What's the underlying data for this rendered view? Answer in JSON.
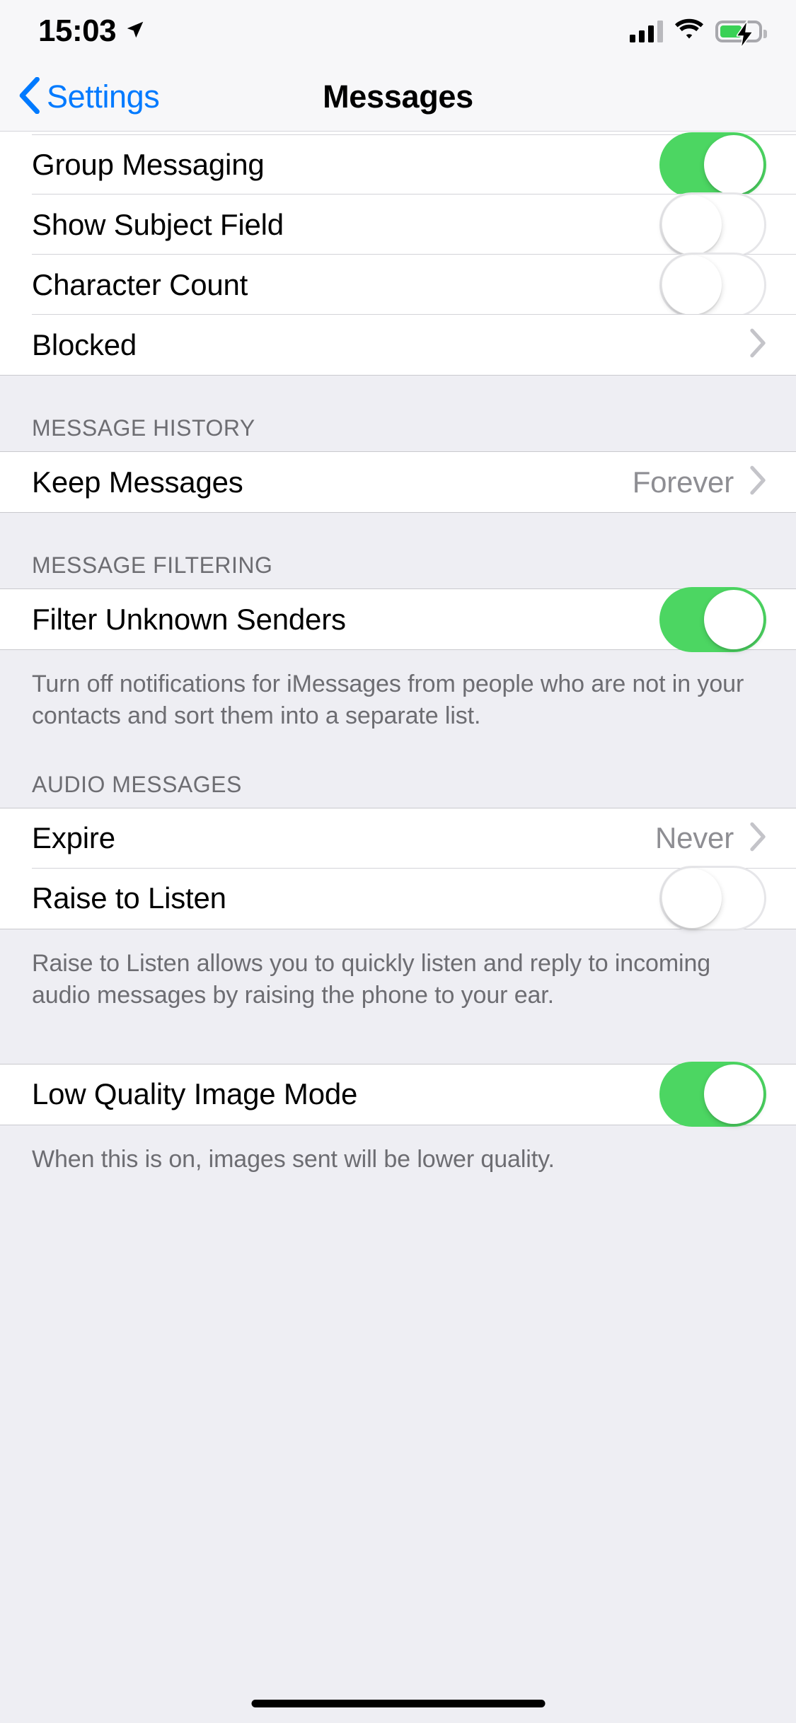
{
  "status_bar": {
    "time": "15:03",
    "location_icon": "location-arrow-icon",
    "cellular_icon": "cellular-bars-icon",
    "cellular_bars_filled": 3,
    "cellular_bars_total": 4,
    "wifi_icon": "wifi-icon",
    "battery_icon": "battery-charging-icon",
    "battery_level_percent": 58,
    "battery_charging": true
  },
  "nav_bar": {
    "back_icon": "chevron-left-icon",
    "back_label": "Settings",
    "title": "Messages",
    "accent_color": "#007aff"
  },
  "colors": {
    "toggle_on": "#4cd662",
    "toggle_off_track": "#ffffff",
    "group_background": "#ffffff",
    "page_background": "#eeeef3",
    "secondary_text": "#8e8e93",
    "header_text": "#6d6d72"
  },
  "sections": [
    {
      "header": "",
      "footer": "",
      "rows": [
        {
          "label": "Group Messaging",
          "type": "toggle",
          "value": "on"
        },
        {
          "label": "Show Subject Field",
          "type": "toggle",
          "value": "off"
        },
        {
          "label": "Character Count",
          "type": "toggle",
          "value": "off"
        },
        {
          "label": "Blocked",
          "type": "disclosure",
          "value": ""
        }
      ]
    },
    {
      "header": "MESSAGE HISTORY",
      "footer": "",
      "rows": [
        {
          "label": "Keep Messages",
          "type": "disclosure",
          "value": "Forever"
        }
      ]
    },
    {
      "header": "MESSAGE FILTERING",
      "footer": "Turn off notifications for iMessages from people who are not in your contacts and sort them into a separate list.",
      "rows": [
        {
          "label": "Filter Unknown Senders",
          "type": "toggle",
          "value": "on"
        }
      ]
    },
    {
      "header": "AUDIO MESSAGES",
      "footer": "Raise to Listen allows you to quickly listen and reply to incoming audio messages by raising the phone to your ear.",
      "rows": [
        {
          "label": "Expire",
          "type": "disclosure",
          "value": "Never"
        },
        {
          "label": "Raise to Listen",
          "type": "toggle",
          "value": "off"
        }
      ]
    },
    {
      "header": "",
      "footer": "When this is on, images sent will be lower quality.",
      "rows": [
        {
          "label": "Low Quality Image Mode",
          "type": "toggle",
          "value": "on"
        }
      ]
    }
  ],
  "home_indicator": "home-indicator"
}
